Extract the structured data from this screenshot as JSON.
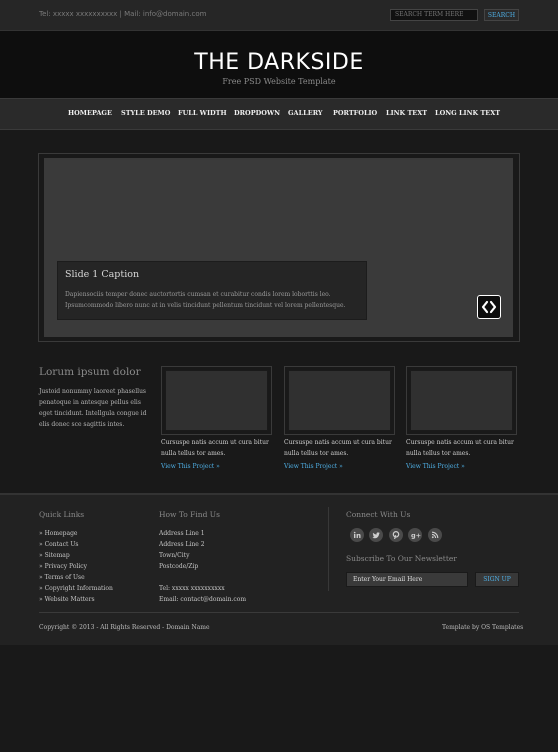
{
  "topbar": {
    "contact": "Tel: xxxxx xxxxxxxxxx | Mail: info@domain.com",
    "search_placeholder": "SEARCH TERM HERE",
    "search_button": "SEARCH"
  },
  "header": {
    "logo": "THE DARKSIDE",
    "tagline": "Free PSD Website Template"
  },
  "nav": {
    "items": [
      "HOMEPAGE",
      "STYLE DEMO",
      "FULL WIDTH",
      "DROPDOWN",
      "GALLERY",
      "PORTFOLIO",
      "LINK TEXT",
      "LONG LINK TEXT"
    ]
  },
  "slider": {
    "caption_title": "Slide 1 Caption",
    "caption_text": "Dapiensociis temper donec auctortortis cumsan et curabitur condis lorem loborttis leo. Ipsumcommodo libero nunc at in velis tincidunt pellentum tincidunt vel lorem pellentesque.",
    "arrow_icons": "chevron-left-right-icon"
  },
  "projects": {
    "heading": "Lorum ipsum dolor",
    "intro": "Justoid nonummy laoreet phasellus penatoque in antesque pellus elis eget tincidunt. Intellgula congue id elis donec sce sagittis intes.",
    "items": [
      {
        "text": "Cursuspe natis accum ut cura bitur nulla tellus tor ames.",
        "link": "View This Project »"
      },
      {
        "text": "Cursuspe natis accum ut cura bitur nulla tellus tor ames.",
        "link": "View This Project »"
      },
      {
        "text": "Cursuspe natis accum ut cura bitur nulla tellus tor ames.",
        "link": "View This Project »"
      }
    ]
  },
  "footer": {
    "quick_links_heading": "Quick Links",
    "quick_links": [
      "» Homepage",
      "» Contact Us",
      "» Sitemap",
      "» Privacy Policy",
      "» Terms of Use",
      "» Copyright Information",
      "» Website Matters"
    ],
    "find_us_heading": "How To Find Us",
    "address": [
      "Address Line 1",
      "Address Line 2",
      "Town/City",
      "Postcode/Zip"
    ],
    "tel": "Tel: xxxxx xxxxxxxxxx",
    "email": "Email: contact@domain.com",
    "connect_heading": "Connect With Us",
    "social_icons": [
      "linkedin-icon",
      "twitter-icon",
      "pinterest-icon",
      "google-plus-icon",
      "rss-icon"
    ],
    "newsletter_heading": "Subscribe To Our Newsletter",
    "newsletter_placeholder": "Enter Your Email Here",
    "newsletter_button": "SIGN UP",
    "copyright": "Copyright © 2013 - All Rights Reserved - Domain Name",
    "credit": "Template by OS Templates"
  },
  "colors": {
    "accent": "#4fb0e6",
    "background": "#191919",
    "header": "#0e0e0e"
  }
}
